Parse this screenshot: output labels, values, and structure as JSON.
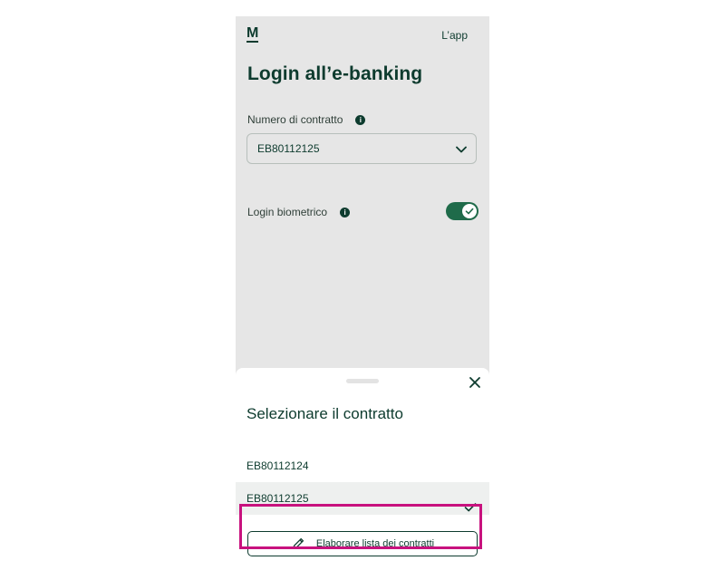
{
  "header": {
    "logo": "M",
    "app_link": "L’app"
  },
  "page": {
    "title": "Login all’e-banking"
  },
  "contract_field": {
    "label": "Numero di contratto",
    "info_icon": "i",
    "selected_value": "EB80112125"
  },
  "biometric": {
    "label": "Login biometrico",
    "info_icon": "i",
    "enabled": true
  },
  "sheet": {
    "title": "Selezionare il contratto",
    "options": [
      {
        "label": "EB80112124",
        "selected": false
      },
      {
        "label": "EB80112125",
        "selected": true
      }
    ],
    "edit_button_label": "Elaborare lista dei contratti"
  },
  "colors": {
    "brand_green": "#0d3b2e",
    "toggle_green": "#1f6b4a",
    "highlight": "#c8127e",
    "background_gray": "#e6e6e6"
  },
  "icons": {
    "chevron": "chevron-down-icon",
    "close": "close-icon",
    "check": "checkmark-icon",
    "pencil": "pencil-icon",
    "info": "info-icon"
  }
}
